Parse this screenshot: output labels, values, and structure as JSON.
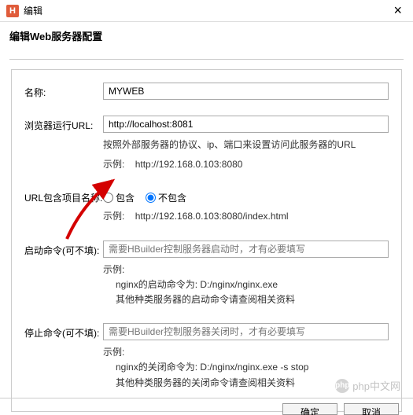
{
  "titlebar": {
    "title": "编辑"
  },
  "subtitle": "编辑Web服务器配置",
  "fields": {
    "name": {
      "label": "名称:",
      "value": "MYWEB"
    },
    "url": {
      "label": "浏览器运行URL:",
      "value": "http://localhost:8081",
      "hint1": "按照外部服务器的协议、ip、端口来设置访问此服务器的URL",
      "hint2_label": "示例:",
      "hint2_value": "http://192.168.0.103:8080"
    },
    "include": {
      "label": "URL包含项目名称:",
      "opt1": "包含",
      "opt2": "不包含",
      "hint_label": "示例:",
      "hint_value": "http://192.168.0.103:8080/index.html"
    },
    "start": {
      "label": "启动命令(可不填):",
      "placeholder": "需要HBuilder控制服务器启动时，才有必要填写",
      "hint_label": "示例:",
      "hint_line1": "nginx的启动命令为:  D:/nginx/nginx.exe",
      "hint_line2": "其他种类服务器的启动命令请查阅相关资料"
    },
    "stop": {
      "label": "停止命令(可不填):",
      "placeholder": "需要HBuilder控制服务器关闭时，才有必要填写",
      "hint_label": "示例:",
      "hint_line1": "nginx的关闭命令为:  D:/nginx/nginx.exe -s stop",
      "hint_line2": "其他种类服务器的关闭命令请查阅相关资料"
    }
  },
  "watermark": "php中文网",
  "buttons": {
    "ok": "确定",
    "cancel": "取消"
  }
}
